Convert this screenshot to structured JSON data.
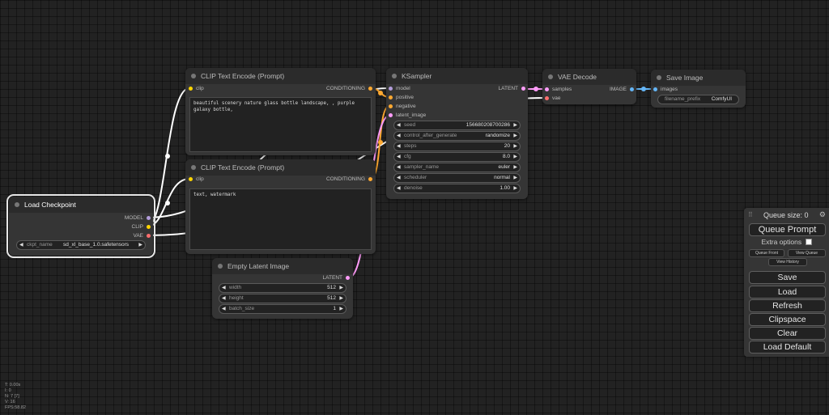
{
  "nodes": {
    "clip_pos": {
      "title": "CLIP Text Encode (Prompt)",
      "input_clip": "clip",
      "output": "CONDITIONING",
      "text": "beautiful scenery nature glass bottle landscape, , purple galaxy bottle,"
    },
    "clip_neg": {
      "title": "CLIP Text Encode (Prompt)",
      "input_clip": "clip",
      "output": "CONDITIONING",
      "text": "text, watermark"
    },
    "ksampler": {
      "title": "KSampler",
      "inputs": [
        "model",
        "positive",
        "negative",
        "latent_image"
      ],
      "output": "LATENT",
      "widgets": [
        {
          "label": "seed",
          "value": "156680208700286"
        },
        {
          "label": "control_after_generate",
          "value": "randomize"
        },
        {
          "label": "steps",
          "value": "20"
        },
        {
          "label": "cfg",
          "value": "8.0"
        },
        {
          "label": "sampler_name",
          "value": "euler"
        },
        {
          "label": "scheduler",
          "value": "normal"
        },
        {
          "label": "denoise",
          "value": "1.00"
        }
      ]
    },
    "vae_decode": {
      "title": "VAE Decode",
      "inputs": [
        "samples",
        "vae"
      ],
      "output": "IMAGE"
    },
    "save_image": {
      "title": "Save Image",
      "input_images": "images",
      "widget": {
        "label": "filename_prefix",
        "value": "ComfyUI"
      }
    },
    "load_checkpoint": {
      "title": "Load Checkpoint",
      "outputs": [
        "MODEL",
        "CLIP",
        "VAE"
      ],
      "widget": {
        "label": "ckpt_name",
        "value": "sd_xl_base_1.0.safetensors"
      }
    },
    "empty_latent": {
      "title": "Empty Latent Image",
      "output": "LATENT",
      "widgets": [
        {
          "label": "width",
          "value": "512"
        },
        {
          "label": "height",
          "value": "512"
        },
        {
          "label": "batch_size",
          "value": "1"
        }
      ]
    }
  },
  "menu": {
    "queue_size": "Queue size: 0",
    "queue_prompt": "Queue Prompt",
    "extra_options": "Extra options",
    "queue_front": "Queue Front",
    "view_queue": "View Queue",
    "view_history": "View History",
    "save": "Save",
    "load": "Load",
    "refresh": "Refresh",
    "clipspace": "Clipspace",
    "clear": "Clear",
    "load_default": "Load Default"
  },
  "stats": [
    "T: 0.00s",
    "I: 0",
    "N: 7 [7]",
    "V: 16",
    "FPS:58.82"
  ],
  "colors": {
    "model": "#b39ddb",
    "clip": "#ffd500",
    "vae": "#ff6e6e",
    "conditioning": "#ffa931",
    "latent": "#ff9cf9",
    "image": "#64b5f6",
    "node_bg": "#353535",
    "node_title_bg": "#2b2b2b",
    "canvas_bg": "#222222"
  }
}
